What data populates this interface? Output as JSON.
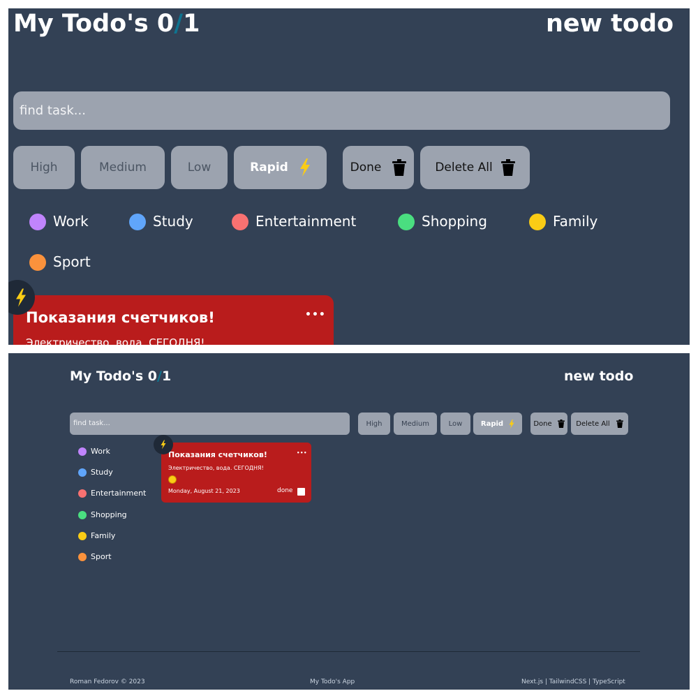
{
  "app": {
    "title_prefix": "My Todo's 0",
    "title_sep": "/",
    "title_total": "1",
    "new_todo": "new todo"
  },
  "search": {
    "placeholder": "find task..."
  },
  "filters": {
    "high": "High",
    "medium": "Medium",
    "low": "Low",
    "rapid": "Rapid"
  },
  "actions": {
    "done": "Done",
    "delete_all": "Delete All"
  },
  "categories": [
    {
      "name": "Work",
      "color": "#c084fc"
    },
    {
      "name": "Study",
      "color": "#60a5fa"
    },
    {
      "name": "Entertainment",
      "color": "#f87171"
    },
    {
      "name": "Shopping",
      "color": "#4ade80"
    },
    {
      "name": "Family",
      "color": "#facc15"
    },
    {
      "name": "Sport",
      "color": "#fb923c"
    }
  ],
  "todo": {
    "title": "Показания счетчиков!",
    "description": "Электричество, вода. СЕГОДНЯ!",
    "date": "Monday, August 21, 2023",
    "done_label": "done",
    "menu": "•••"
  },
  "footer": {
    "author": "Roman Fedorov © 2023",
    "app_name": "My Todo's App",
    "stack": "Next.js | TailwindCSS | TypeScript"
  },
  "colors": {
    "background": "#334155",
    "pill": "#9ca3af",
    "card": "#b91c1c",
    "accent": "#0e7490",
    "lightning": "#facc15"
  }
}
